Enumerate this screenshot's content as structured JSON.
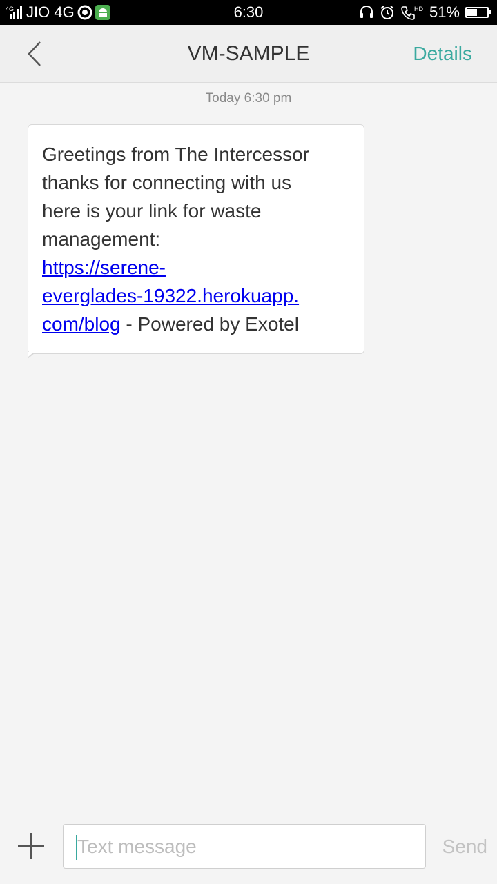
{
  "status_bar": {
    "network_small": "4G",
    "carrier": "JIO 4G",
    "time": "6:30",
    "hd_label": "HD",
    "battery": "51%",
    "battery_level": 0.51,
    "icons": [
      "signal-icon",
      "android-notification-icon",
      "headset-icon",
      "alarm-icon",
      "volte-call-icon",
      "battery-icon"
    ]
  },
  "header": {
    "title": "VM-SAMPLE",
    "details_label": "Details",
    "accent_color": "#3aa99f"
  },
  "conversation": {
    "timestamp": "Today  6:30 pm",
    "messages": [
      {
        "lines": [
          "Greetings from The Intercessor",
          "thanks for connecting with us",
          "here is your link for waste",
          "management:"
        ],
        "link_lines": [
          "https://serene-",
          "everglades-19322.herokuapp.",
          "com/blog"
        ],
        "suffix": " - Powered by Exotel"
      }
    ]
  },
  "composer": {
    "placeholder": "Text message",
    "send_label": "Send"
  }
}
